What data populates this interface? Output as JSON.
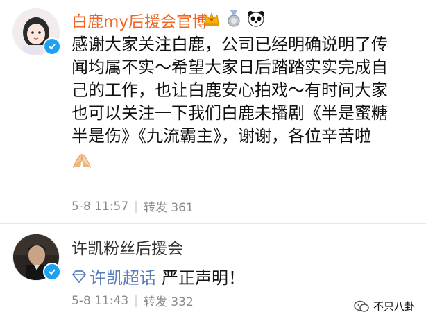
{
  "post1": {
    "username": "白鹿my后援会官博",
    "content_lines": [
      "感谢大家关注白鹿，公司已经明确说明了传",
      "闻均属不实～希望大家日后踏踏实实完成自",
      "己的工作，也让白鹿安心拍戏～有时间大家",
      "也可以关注一下我们白鹿未播剧《半是蜜糖",
      "半是伤》《九流霸主》，谢谢，各位辛苦啦"
    ],
    "date": "5-8 11:57",
    "repost_label": "转发",
    "repost_count": "361",
    "badge_icons": [
      "crown-icon",
      "medal-icon",
      "panda-icon"
    ],
    "emoji_icon": "folded-hands-icon"
  },
  "post2": {
    "username": "许凯粉丝后援会",
    "topic": "许凯超话",
    "text": "严正声明！",
    "date": "5-8 11:43",
    "repost_label": "转发",
    "repost_count": "332"
  },
  "watermark": {
    "text": "不只八卦"
  },
  "colors": {
    "name_orange": "#f06522",
    "verify_blue": "#1da1f2",
    "topic_blue": "#5b7fbd",
    "meta_gray": "#8a8a8a"
  }
}
